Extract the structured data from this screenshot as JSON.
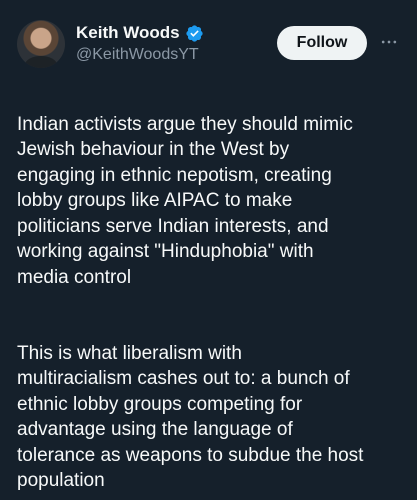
{
  "author": {
    "display_name": "Keith Woods",
    "handle": "@KeithWoodsYT",
    "verified": true,
    "verified_color": "#1d9bf0"
  },
  "actions": {
    "follow_label": "Follow",
    "more_icon": "more-horizontal-icon"
  },
  "tweet": {
    "paragraph_1": "Indian activists argue they should mimic\nJewish behaviour in the West by\nengaging in ethnic nepotism, creating\nlobby groups like AIPAC to make\npoliticians serve Indian interests, and\nworking against \"Hinduphobia\" with\nmedia control",
    "paragraph_2": "This is what liberalism with\nmultiracialism cashes out to: a bunch of\nethnic lobby groups competing for\nadvantage using the language of\ntolerance as weapons to subdue the host\npopulation"
  },
  "theme": {
    "background": "#15202b",
    "text_primary": "#f7f9f9",
    "text_secondary": "#8b98a5"
  }
}
